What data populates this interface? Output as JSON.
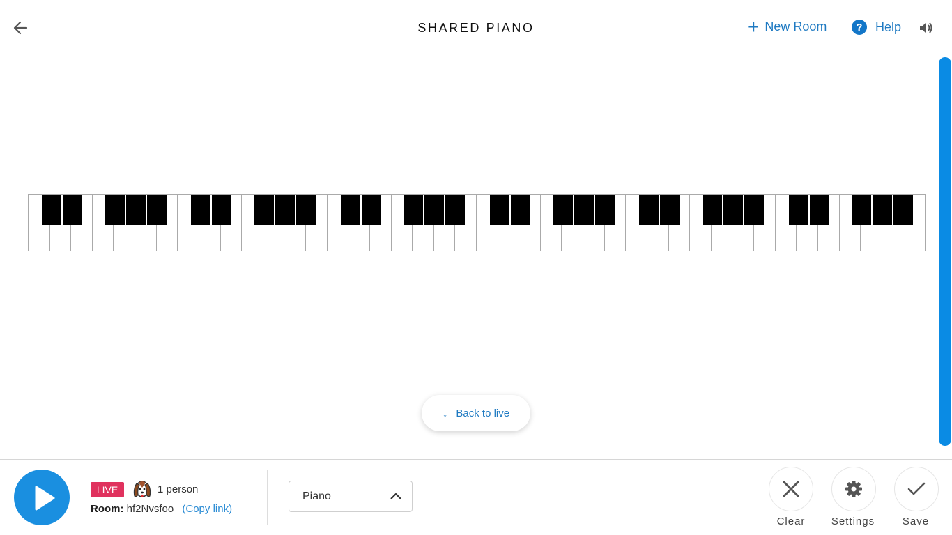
{
  "header": {
    "title": "SHARED PIANO",
    "new_room_label": "New Room",
    "help_label": "Help",
    "icons": {
      "back": "arrow-left-icon",
      "new_room": "plus-icon",
      "help": "question-circle-icon",
      "sound": "speaker-icon"
    }
  },
  "keyboard": {
    "octaves": 6,
    "white_notes": [
      "C",
      "D",
      "E",
      "F",
      "G",
      "A",
      "B"
    ],
    "black_notes": [
      "C#",
      "D#",
      "F#",
      "G#",
      "A#"
    ]
  },
  "back_to_live": {
    "label": "Back to live",
    "icon": "arrow-down-icon"
  },
  "footer": {
    "live_badge": "LIVE",
    "people_count": "1 person",
    "room_label": "Room:",
    "room_id": "hf2Nvsfoo",
    "copy_link": "(Copy link)",
    "instrument": {
      "selected": "Piano"
    },
    "actions": [
      {
        "label": "Clear",
        "icon": "close-icon"
      },
      {
        "label": "Settings",
        "icon": "gear-icon"
      },
      {
        "label": "Save",
        "icon": "check-icon"
      }
    ]
  },
  "colors": {
    "accent": "#1a8fe0",
    "link": "#1f7ac2",
    "live": "#e0325e"
  }
}
